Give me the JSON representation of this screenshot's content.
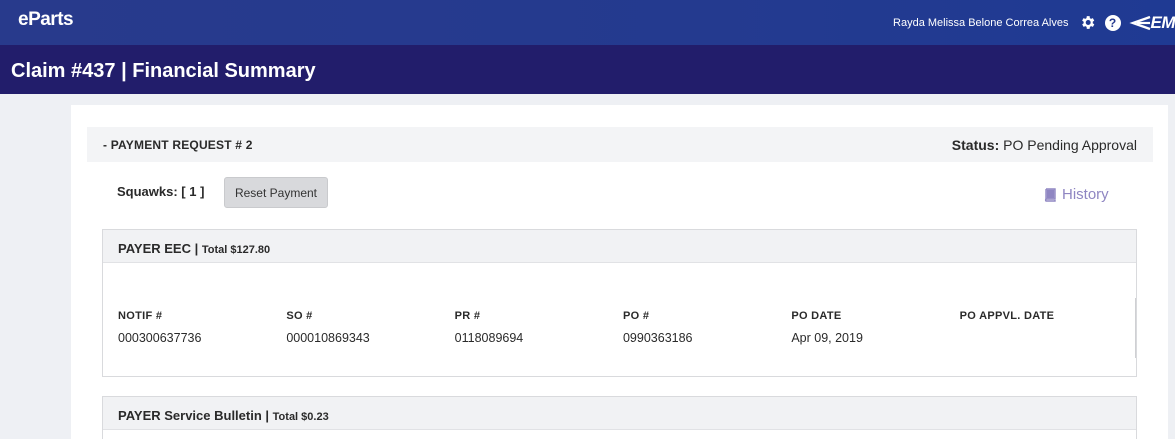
{
  "app": {
    "logo": "eParts",
    "user_name": "Rayda Melissa Belone Correa Alves",
    "brand": "EM"
  },
  "page": {
    "title": "Claim #437 | Financial Summary"
  },
  "payment_request": {
    "title": "- PAYMENT REQUEST # 2",
    "status_label": "Status:",
    "status_value": "PO Pending Approval",
    "squawks_label": "Squawks: [ 1 ]",
    "reset_label": "Reset Payment",
    "history_label": "History"
  },
  "payers": [
    {
      "name": "PAYER EEC",
      "total": "Total $127.80",
      "fields": [
        {
          "label": "NOTIF #",
          "value": "000300637736"
        },
        {
          "label": "SO #",
          "value": "000010869343"
        },
        {
          "label": "PR #",
          "value": "0118089694"
        },
        {
          "label": "PO #",
          "value": "0990363186"
        },
        {
          "label": "PO DATE",
          "value": "Apr 09, 2019"
        },
        {
          "label": "PO APPVL. DATE",
          "value": ""
        }
      ]
    },
    {
      "name": "PAYER Service Bulletin",
      "total": "Total $0.23"
    }
  ],
  "icons": {
    "settings": "gear-icon",
    "help": "question-circle-icon",
    "history": "book-icon"
  },
  "colors": {
    "topbar": "#283a8c",
    "titlebar": "#221d6b",
    "history_link": "#8f86c2"
  }
}
